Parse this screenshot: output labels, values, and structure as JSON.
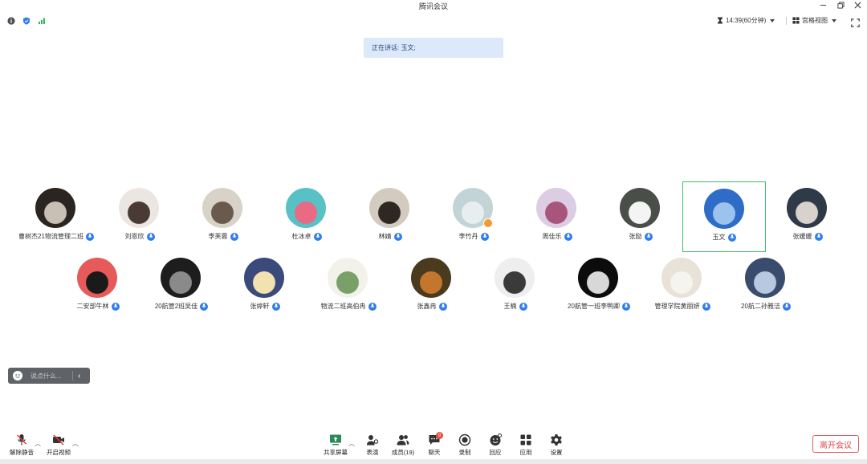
{
  "window": {
    "title": "腾讯会议"
  },
  "status": {
    "timer": "14:39(60分钟)",
    "view_mode": "宫格视图"
  },
  "speaking_banner": "正在讲话: 玉文;",
  "participants": [
    {
      "name": "曹树杰21物流管理二班",
      "bg": "#2b2522",
      "fg": "#c8c0b4"
    },
    {
      "name": "刘恩欣",
      "bg": "#ece6e2",
      "fg": "#4a3a34"
    },
    {
      "name": "李芙蓉",
      "bg": "#d8d2c8",
      "fg": "#6a5a4e"
    },
    {
      "name": "杜冰卓",
      "bg": "#57c1c6",
      "fg": "#e86a84"
    },
    {
      "name": "林婧",
      "bg": "#d4cbc0",
      "fg": "#2e2824"
    },
    {
      "name": "李竹丹",
      "bg": "#c3d4d6",
      "fg": "#e8eef0"
    },
    {
      "name": "周佳乐",
      "bg": "#ddcde4",
      "fg": "#a8557c"
    },
    {
      "name": "张励",
      "bg": "#4a4e48",
      "fg": "#f4f4f4"
    },
    {
      "name": "玉文",
      "bg": "#2e6cc8",
      "fg": "#9cc2ee"
    },
    {
      "name": "张媛媛",
      "bg": "#2e3a48",
      "fg": "#d8d2cc"
    },
    {
      "name": "二安部牛林",
      "bg": "#e65a5a",
      "fg": "#1a1a1a"
    },
    {
      "name": "20航管2班吴佳",
      "bg": "#1d1d1d",
      "fg": "#8a8a8a"
    },
    {
      "name": "张婷轩",
      "bg": "#3a4a7a",
      "fg": "#f2e2b0"
    },
    {
      "name": "物流二班高伯冉",
      "bg": "#f2f2ea",
      "fg": "#7aa06a"
    },
    {
      "name": "张鑫冉",
      "bg": "#4a3a1e",
      "fg": "#c4762e"
    },
    {
      "name": "王楠",
      "bg": "#eeeeee",
      "fg": "#3a3a3a"
    },
    {
      "name": "20航管一班李鸭卿",
      "bg": "#0c0c0c",
      "fg": "#d8d8d8"
    },
    {
      "name": "管理学院黄丽妍",
      "bg": "#e8e2d8",
      "fg": "#f6f4ee"
    },
    {
      "name": "20航二孙雅洁",
      "bg": "#3a4c6e",
      "fg": "#b8c8e0"
    }
  ],
  "active_participant": "玉文",
  "chat": {
    "placeholder": "说点什么..."
  },
  "toolbar": {
    "unmute": "解除静音",
    "start_video": "开启视频",
    "share_screen": "共享屏幕",
    "hand": "表演",
    "members": "成员(19)",
    "chat": "聊天",
    "chat_badge": "9",
    "record": "录制",
    "reactions": "回应",
    "apps": "应用",
    "settings": "设置",
    "leave": "离开会议"
  },
  "colors": {
    "accent": "#2d7cf0",
    "active_border": "#3cc26a",
    "leave": "#e04848"
  }
}
